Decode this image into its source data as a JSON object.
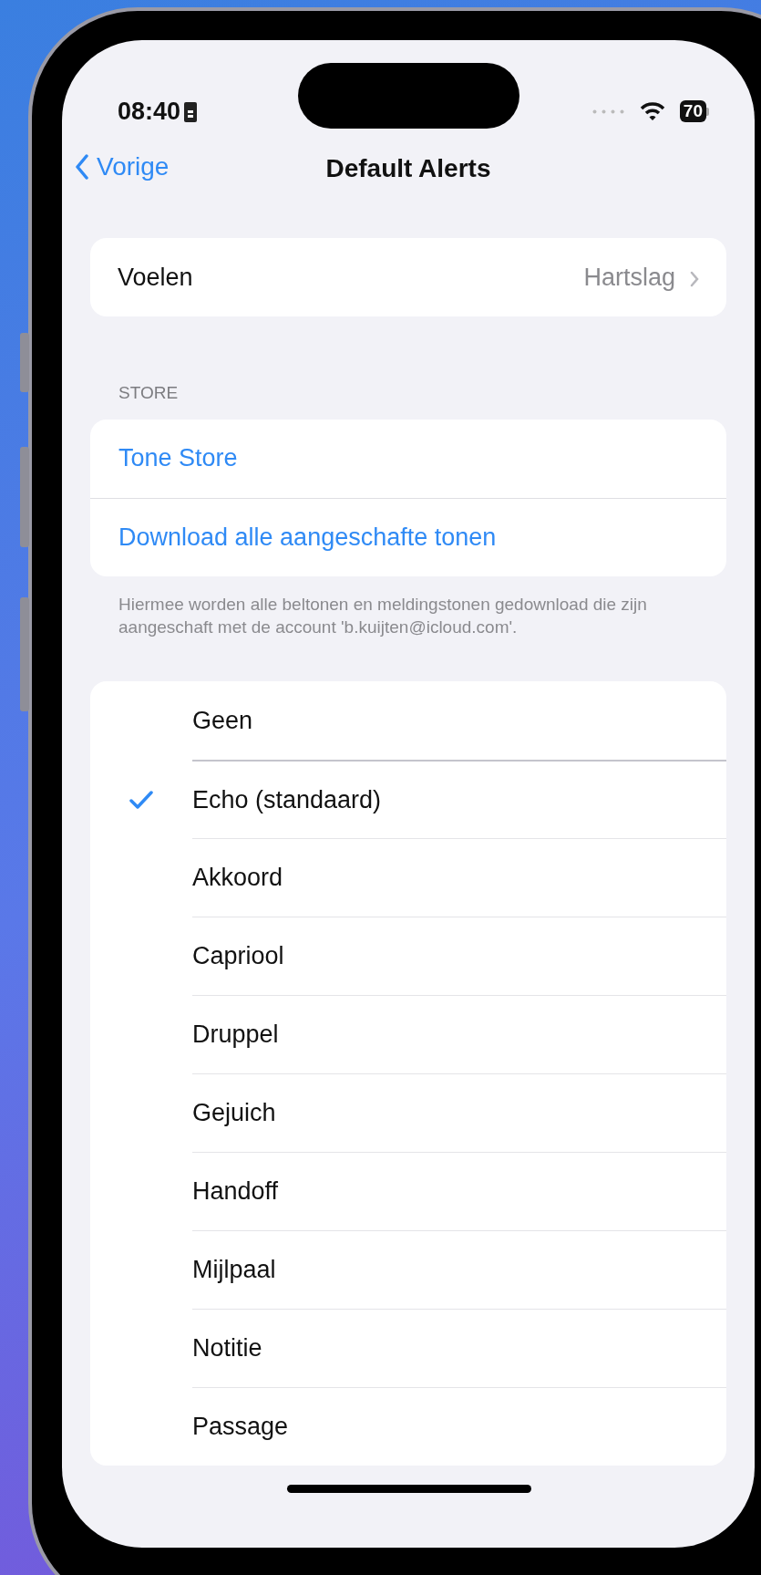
{
  "status_bar": {
    "time": "08:40",
    "battery": "70"
  },
  "nav": {
    "back": "Vorige",
    "title": "Default Alerts"
  },
  "vibration": {
    "label": "Voelen",
    "value": "Hartslag"
  },
  "store": {
    "header": "STORE",
    "links": [
      "Tone Store",
      "Download alle aangeschafte tonen"
    ],
    "footer": "Hiermee worden alle beltonen en meldingstonen gedownload die zijn aangeschaft met de account 'b.kuijten@icloud.com'."
  },
  "tones": [
    {
      "name": "Geen",
      "selected": false
    },
    {
      "name": "Echo (standaard)",
      "selected": true
    },
    {
      "name": "Akkoord",
      "selected": false
    },
    {
      "name": "Capriool",
      "selected": false
    },
    {
      "name": "Druppel",
      "selected": false
    },
    {
      "name": "Gejuich",
      "selected": false
    },
    {
      "name": "Handoff",
      "selected": false
    },
    {
      "name": "Mijlpaal",
      "selected": false
    },
    {
      "name": "Notitie",
      "selected": false
    },
    {
      "name": "Passage",
      "selected": false
    }
  ]
}
